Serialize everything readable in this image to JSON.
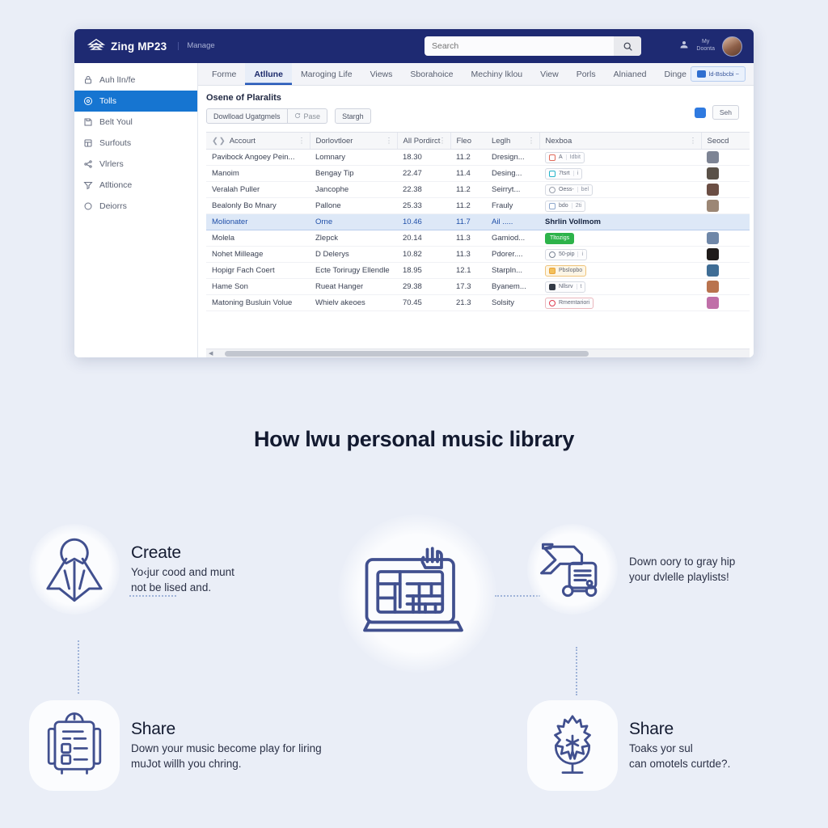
{
  "app": {
    "brand": "Zing MP23",
    "brand_sub": "Manage",
    "logo_icon": "house-logo-icon",
    "search": {
      "value": "",
      "placeholder": "Search",
      "icon": "search-icon"
    },
    "topbar_right": {
      "user_icon": "user-icon",
      "label": "My\nDoonta",
      "avatar": "user-avatar"
    }
  },
  "sidebar": {
    "items": [
      {
        "label": "Auh lIn/fe",
        "icon": "lock-icon",
        "active": false
      },
      {
        "label": "Tolls",
        "icon": "disc-icon",
        "active": true
      },
      {
        "label": "Belt Youl",
        "icon": "save-icon",
        "active": false
      },
      {
        "label": "Surfouts",
        "icon": "grid-icon",
        "active": false
      },
      {
        "label": "Vlrlers",
        "icon": "share-icon",
        "active": false
      },
      {
        "label": "Atltionce",
        "icon": "filter-icon",
        "active": false
      },
      {
        "label": "Deiorrs",
        "icon": "circle-icon",
        "active": false
      }
    ]
  },
  "tabs": [
    {
      "label": "Forme",
      "active": false
    },
    {
      "label": "Atllune",
      "active": true
    },
    {
      "label": "Maroging Life",
      "active": false
    },
    {
      "label": "Views",
      "active": false
    },
    {
      "label": "Sborahoice",
      "active": false
    },
    {
      "label": "Mechiny lklou",
      "active": false
    },
    {
      "label": "View",
      "active": false
    },
    {
      "label": "Porls",
      "active": false
    },
    {
      "label": "Alnianed",
      "active": false
    },
    {
      "label": "Dinge",
      "active": false
    }
  ],
  "tab_cta": {
    "label": "ld-Bsbcbi ~",
    "icon": "badge-icon"
  },
  "panel": {
    "title": "Osene of Plaralits",
    "toolbar": [
      {
        "label": "Dowlload Ugatgmels",
        "icon": ""
      },
      {
        "label": "Pase",
        "icon": "refresh-icon"
      },
      {
        "label": "Stargh",
        "icon": ""
      }
    ],
    "toolbar_right": {
      "chip_icon": "comment-icon",
      "button": "Seh"
    }
  },
  "table": {
    "columns": [
      {
        "label": "Accourt",
        "menu": true
      },
      {
        "label": "Dorlovtloer",
        "menu": true
      },
      {
        "label": "All Pordirct",
        "menu": true
      },
      {
        "label": "Fleo",
        "menu": false
      },
      {
        "label": "Leglh",
        "menu": true
      },
      {
        "label": "Nexboa",
        "menu": true
      },
      {
        "label": "Seocd",
        "menu": false
      }
    ],
    "rows": [
      {
        "name": "Pavibock Angoey Pein...",
        "avatar": "#2f7ae0",
        "col2": "Lomnary",
        "col3": "18.30",
        "col4": "11.2",
        "col5": "Dresign...",
        "badge": {
          "text": "A",
          "sub": "Idbit",
          "style": "outline",
          "dot": "#e06a5a"
        },
        "rowav": "#7d8494",
        "selected": false
      },
      {
        "name": "Manoim",
        "avatar": "#4b4138",
        "col2": "Bengay Tip",
        "col3": "22.47",
        "col4": "11.4",
        "col5": "Desing...",
        "badge": {
          "text": "7tsrt",
          "sub": "i",
          "style": "outline",
          "dot": "#22b3c9"
        },
        "rowav": "#5a5148",
        "selected": false
      },
      {
        "name": "Veralah Puller",
        "avatar": "#8d5a4a",
        "col2": "Jancophe",
        "col3": "22.38",
        "col4": "11.2",
        "col5": "Seirryt...",
        "badge": {
          "text": "Oess-",
          "sub": "bel",
          "style": "outline",
          "dot": "#9aa1ad"
        },
        "rowav": "#6b4e44",
        "selected": false
      },
      {
        "name": "Bealonly Bo Mnary",
        "avatar": "#c08b6a",
        "col2": "Pallone",
        "col3": "25.33",
        "col4": "11.2",
        "col5": "Frauly",
        "badge": {
          "text": "bdo",
          "sub": "2ti",
          "style": "outline",
          "dot": "#8fa8cd"
        },
        "rowav": "#9c8775",
        "selected": false
      },
      {
        "name": "Molionater",
        "avatar": "#e55b6a",
        "col2": "Orne",
        "col3": "10.46",
        "col4": "11.7",
        "col5": "Ail .....",
        "badge": {
          "text": "Shrlin Vollmom",
          "sub": "",
          "style": "plain",
          "dot": ""
        },
        "rowav": "dot-red",
        "selected": true
      },
      {
        "name": "Molela",
        "avatar": "#e8a8c8",
        "col2": "Zlepck",
        "col3": "20.14",
        "col4": "11.3",
        "col5": "Gamiod...",
        "badge": {
          "text": "Tltozigs",
          "sub": "",
          "style": "green",
          "dot": ""
        },
        "rowav": "#6f87a8",
        "selected": false
      },
      {
        "name": "Nohet Milleage",
        "avatar": "#434a58",
        "col2": "D Delerys",
        "col3": "10.82",
        "col4": "11.3",
        "col5": "Pdorer....",
        "badge": {
          "text": "50-pip",
          "sub": "i",
          "style": "outline",
          "dot": "#7a8494"
        },
        "rowav": "#1f1b1a",
        "selected": false
      },
      {
        "name": "Hopigr Fach Coert",
        "avatar": "#e8607a",
        "col2": "Ecte Torirugy Ellendle",
        "col3": "18.95",
        "col4": "12.1",
        "col5": "Starpln...",
        "badge": {
          "text": "Pbslopbo",
          "sub": "",
          "style": "amber",
          "dot": "#e8a33a"
        },
        "rowav": "#3f6d95",
        "selected": false
      },
      {
        "name": "Hame Son",
        "avatar": "#7a2a8c",
        "col2": "Rueat Hanger",
        "col3": "29.38",
        "col4": "17.3",
        "col5": "Byanem...",
        "badge": {
          "text": "Nllsrv",
          "sub": "t",
          "style": "outline",
          "dot": "#333a46"
        },
        "rowav": "#b9734e",
        "selected": false
      },
      {
        "name": "Matoning Busluin Volue",
        "avatar": "#e9913f",
        "col2": "Whielv akeoes",
        "col3": "70.45",
        "col4": "21.3",
        "col5": "Solsity",
        "badge": {
          "text": "Rmemtariori",
          "sub": "",
          "style": "outline",
          "dot": "#e03b4e"
        },
        "rowav": "#c06fa8",
        "selected": false
      }
    ]
  },
  "headline": "How lwu personal music library",
  "features": [
    {
      "id": "create",
      "icon": "rocket-icon",
      "title": "Create",
      "desc": "Yo‹jur cood and munt\nnot be lised and."
    },
    {
      "id": "download",
      "icon": "delivery-truck-icon",
      "title": "",
      "desc": "Down oory to gray hip\nyour dvlelle playlists!"
    },
    {
      "id": "share-left",
      "icon": "clipboard-icon",
      "title": "Share",
      "desc": "Down your music become play for liring\nmuJot willh you chring."
    },
    {
      "id": "share-right",
      "icon": "microphone-icon",
      "title": "Share",
      "desc": "Toaks yor sul\ncan omotels curtde?."
    }
  ],
  "center_illustration": {
    "icon": "dashboard-cursor-icon"
  },
  "colors": {
    "page_bg": "#eaeef7",
    "topbar": "#1e2a72",
    "accent_blue": "#1675d1",
    "tab_active": "#2357b8",
    "selection": "#dde8f7",
    "icon_stroke": "#41508f",
    "headline": "#131a30"
  }
}
